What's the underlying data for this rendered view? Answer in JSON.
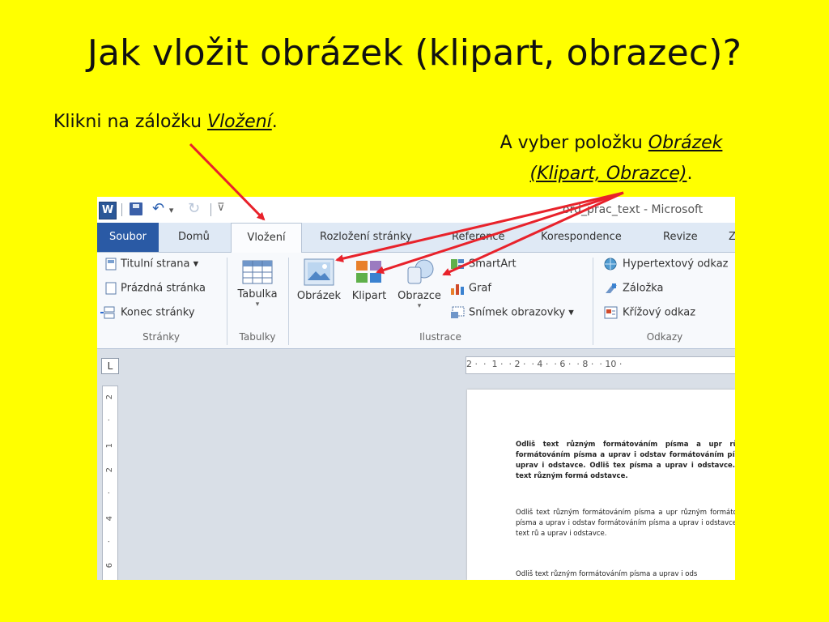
{
  "slide": {
    "title": "Jak vložit obrázek (klipart, obrazec)?",
    "note1_prefix": "Klikni na záložku ",
    "note1_link": "Vložení",
    "note1_suffix": ".",
    "note2_prefix": "A vyber položku ",
    "note2_link_line1": "Obrázek",
    "note2_link_line2": "(Klipart, Obrazce)",
    "note2_suffix": ".",
    "arrow_color": "#e8222b"
  },
  "word": {
    "app_icon": "W",
    "window_title": "ord_prac_text - Microsoft",
    "tabs": [
      "Soubor",
      "Domů",
      "Vložení",
      "Rozložení stránky",
      "Reference",
      "Korespondence",
      "Revize",
      "Z"
    ],
    "groups": {
      "pages": {
        "label": "Stránky",
        "items": [
          "Titulní strana ▾",
          "Prázdná stránka",
          "Konec stránky"
        ]
      },
      "tables": {
        "label": "Tabulky",
        "button": "Tabulka"
      },
      "illustrations": {
        "label": "Ilustrace",
        "buttons": [
          "Obrázek",
          "Klipart",
          "Obrazce"
        ],
        "small_items": [
          "SmartArt",
          "Graf",
          "Snímek obrazovky ▾"
        ]
      },
      "links": {
        "label": "Odkazy",
        "items": [
          "Hypertextový odkaz",
          "Záložka",
          "Křížový odkaz"
        ]
      }
    },
    "ruler_h": "2 ·  ·  1 ·  · 2 ·  · 4 ·  · 6 ·  · 8 ·  · 10 ·",
    "ruler_v": [
      "2",
      "·",
      "1",
      "2",
      "·",
      "4",
      "·",
      "6"
    ],
    "tab_selector": "L",
    "doc_paragraphs": [
      "Odliš text různým formátováním písma a upr různým formátováním písma a uprav i odstav formátováním písma a uprav i odstavce. Odliš tex písma a uprav i odstavce. Odliš text různým formá odstavce.",
      "Odliš text různým formátováním písma a upr různým formátováním písma a uprav i odstav formátováním písma a uprav i odstavce. Odliš text rů a uprav i odstavce.",
      "Odliš text různým formátováním písma a uprav i ods"
    ]
  }
}
